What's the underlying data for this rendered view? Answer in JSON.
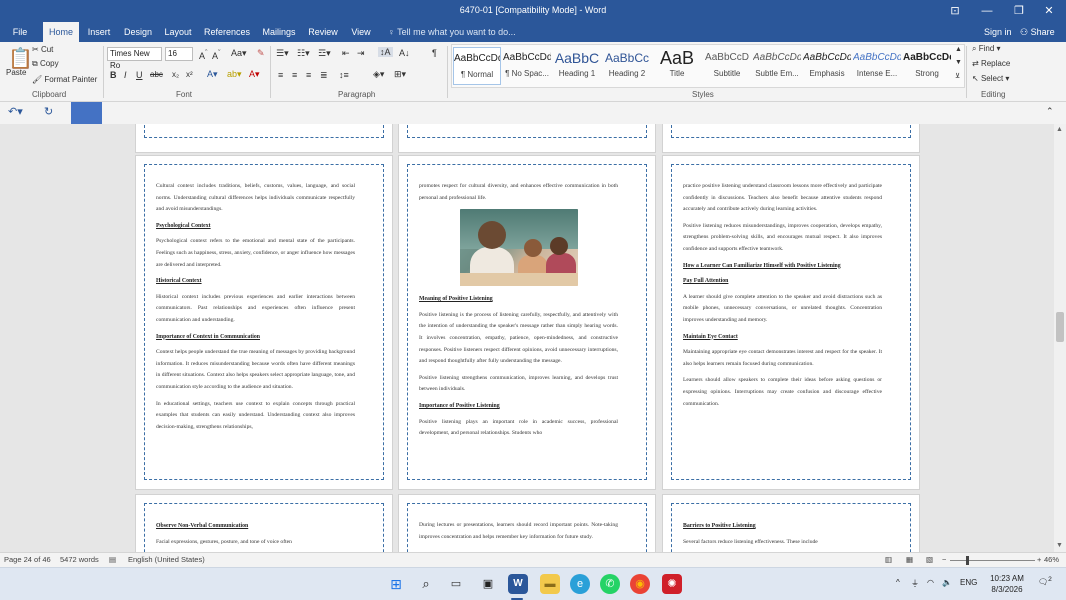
{
  "window": {
    "title": "6470-01 [Compatibility Mode] - Word"
  },
  "tabs": [
    "File",
    "Home",
    "Insert",
    "Design",
    "Layout",
    "References",
    "Mailings",
    "Review",
    "View"
  ],
  "tell_me": "Tell me what you want to do...",
  "sign_in": "Sign in",
  "share": "Share",
  "ribbon": {
    "clipboard": {
      "paste": "Paste",
      "cut": "Cut",
      "copy": "Copy",
      "format_painter": "Format Painter",
      "label": "Clipboard"
    },
    "font": {
      "name": "Times New Ro",
      "size": "16",
      "label": "Font"
    },
    "paragraph": {
      "label": "Paragraph"
    },
    "styles": {
      "label": "Styles",
      "items": [
        {
          "sample": "AaBbCcDd",
          "name": "¶ Normal"
        },
        {
          "sample": "AaBbCcDd",
          "name": "¶ No Spac..."
        },
        {
          "sample": "AaBbC",
          "name": "Heading 1"
        },
        {
          "sample": "AaBbCc",
          "name": "Heading 2"
        },
        {
          "sample": "AaB",
          "name": "Title"
        },
        {
          "sample": "AaBbCcD",
          "name": "Subtitle"
        },
        {
          "sample": "AaBbCcDd",
          "name": "Subtle Em..."
        },
        {
          "sample": "AaBbCcDd",
          "name": "Emphasis"
        },
        {
          "sample": "AaBbCcDd",
          "name": "Intense E..."
        },
        {
          "sample": "AaBbCcDc",
          "name": "Strong"
        }
      ]
    },
    "editing": {
      "find": "Find",
      "replace": "Replace",
      "select": "Select",
      "label": "Editing"
    }
  },
  "pages": {
    "p1": {
      "intro": "Cultural context includes traditions, beliefs, customs, values, language, and social norms. Understanding cultural differences helps individuals communicate respectfully and avoid misunderstandings.",
      "h_psych": "Psychological Context",
      "psych": "Psychological context refers to the emotional and mental state of the participants. Feelings such as happiness, stress, anxiety, confidence, or anger influence how messages are delivered and interpreted.",
      "h_hist": "Historical Context",
      "hist": "Historical context includes previous experiences and earlier interactions between communicators. Past relationships and experiences often influence present communication and understanding.",
      "h_imp": "Importance of Context in Communication",
      "imp": "Context helps people understand the true meaning of messages by providing background information. It reduces misunderstanding because words often have different meanings in different situations. Context also helps speakers select appropriate language, tone, and communication style according to the audience and situation.",
      "edu": "In educational settings, teachers use context to explain concepts through practical examples that students can easily understand. Understanding context also improves decision-making, strengthens relationships,"
    },
    "p2": {
      "intro": "promotes respect for cultural diversity, and enhances effective communication in both personal and professional life.",
      "h_meaning": "Meaning of Positive Listening",
      "meaning": "Positive listening is the process of listening carefully, respectfully, and attentively with the intention of understanding the speaker's message rather than simply hearing words. It involves concentration, empathy, patience, open-mindedness, and constructive responses. Positive listeners respect different opinions, avoid unnecessary interruptions, and respond thoughtfully after fully understanding the message.",
      "strength": "Positive listening strengthens communication, improves learning, and develops trust between individuals.",
      "h_importance": "Importance of Positive Listening",
      "importance": "Positive listening plays an important role in academic success, professional development, and personal relationships. Students who"
    },
    "p3": {
      "intro": "practice positive listening understand classroom lessons more effectively and participate confidently in discussions. Teachers also benefit because attentive students respond accurately and contribute actively during learning activities.",
      "reduces": "Positive listening reduces misunderstandings, improves cooperation, develops empathy, strengthens problem-solving skills, and encourages mutual respect. It also improves confidence and supports effective teamwork.",
      "h_how": "How a Learner Can Familiarize Himself with Positive Listening",
      "h_attention": "Pay Full Attention",
      "attention": "A learner should give complete attention to the speaker and avoid distractions such as mobile phones, unnecessary conversations, or unrelated thoughts. Concentration improves understanding and memory.",
      "h_eye": "Maintain Eye Contact",
      "eye": "Maintaining appropriate eye contact demonstrates interest and respect for the speaker. It also helps learners remain focused during communication.",
      "allow": "Learners should allow speakers to complete their ideas before asking questions or expressing opinions. Interruptions may create confusion and discourage effective communication."
    },
    "p4": {
      "h_nonverbal": "Observe Non-Verbal Communication",
      "nonverbal": "Facial expressions, gestures, posture, and tone of voice often"
    },
    "p5": {
      "lectures": "During lectures or presentations, learners should record important points. Note-taking improves concentration and helps remember key information for future study."
    },
    "p6": {
      "h_barriers": "Barriers to Positive Listening",
      "barriers": "Several factors reduce listening effectiveness. These include"
    }
  },
  "status": {
    "page": "Page 24 of 46",
    "words": "5472 words",
    "language": "English (United States)",
    "zoom": "46%",
    "zoom_level": 0.46
  },
  "taskbar": {
    "lang": "ENG",
    "time": "10:23 AM",
    "date": "8/3/2026",
    "notifications": "2"
  }
}
